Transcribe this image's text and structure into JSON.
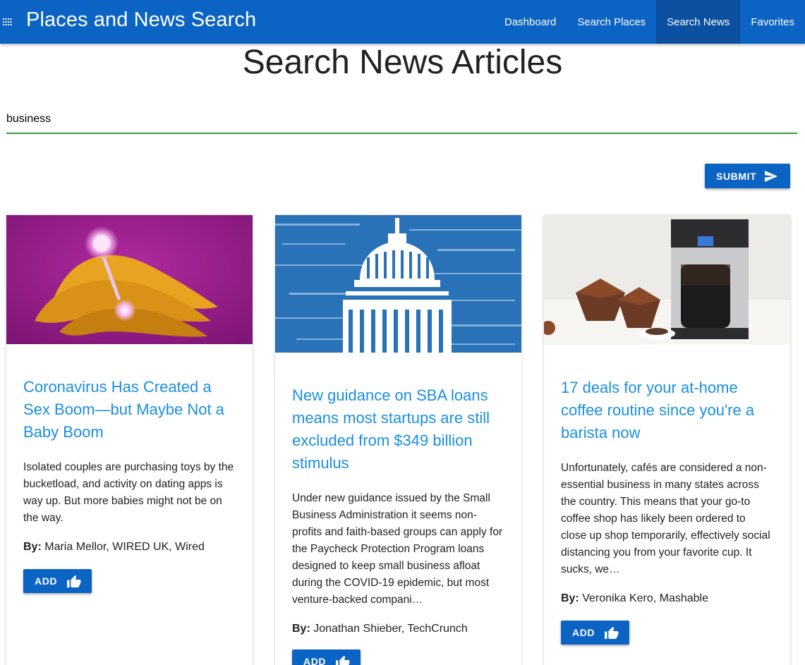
{
  "app": {
    "title": "Places and News Search",
    "nav": [
      {
        "label": "Dashboard",
        "active": false
      },
      {
        "label": "Search Places",
        "active": false
      },
      {
        "label": "Search News",
        "active": true
      },
      {
        "label": "Favorites",
        "active": false
      }
    ]
  },
  "page": {
    "heading": "Search News Articles",
    "search_value": "business",
    "submit_label": "SUBMIT"
  },
  "articles": [
    {
      "title": "Coronavirus Has Created a Sex Boom—but Maybe Not a Baby Boom",
      "description": "Isolated couples are purchasing toys by the bucketload, and activity on dating apps is way up. But more babies might not be on the way.",
      "by_label": "By:",
      "author": "Maria Mellor, WIRED UK, Wired",
      "add_label": "ADD"
    },
    {
      "title": "New guidance on SBA loans means most startups are still excluded from $349 billion stimulus",
      "description": "Under new guidance issued by the Small Business Administration it seems non-profits and faith-based groups can apply for the Paycheck Protection Program loans designed to keep small business afloat during the COVID-19 epidemic, but most venture-backed compani…",
      "by_label": "By:",
      "author": "Jonathan Shieber, TechCrunch",
      "add_label": "ADD"
    },
    {
      "title": "17 deals for your at-home coffee routine since you're a barista now",
      "description": "Unfortunately, cafés are considered a non-essential business in many states across the country. This means that your go-to coffee shop has likely been ordered to close up shop temporarily, effectively social distancing you from your favorite cup. It sucks, we…",
      "by_label": "By:",
      "author": "Veronika Kero, Mashable",
      "add_label": "ADD"
    }
  ],
  "colors": {
    "primary": "#0b63c4",
    "nav_active": "#0a4fa0",
    "link": "#1a8fe0",
    "input_underline": "#3a9a3e"
  },
  "icons": {
    "menu": "apps-grid-icon",
    "submit": "send-icon",
    "add": "thumb-up-icon"
  }
}
